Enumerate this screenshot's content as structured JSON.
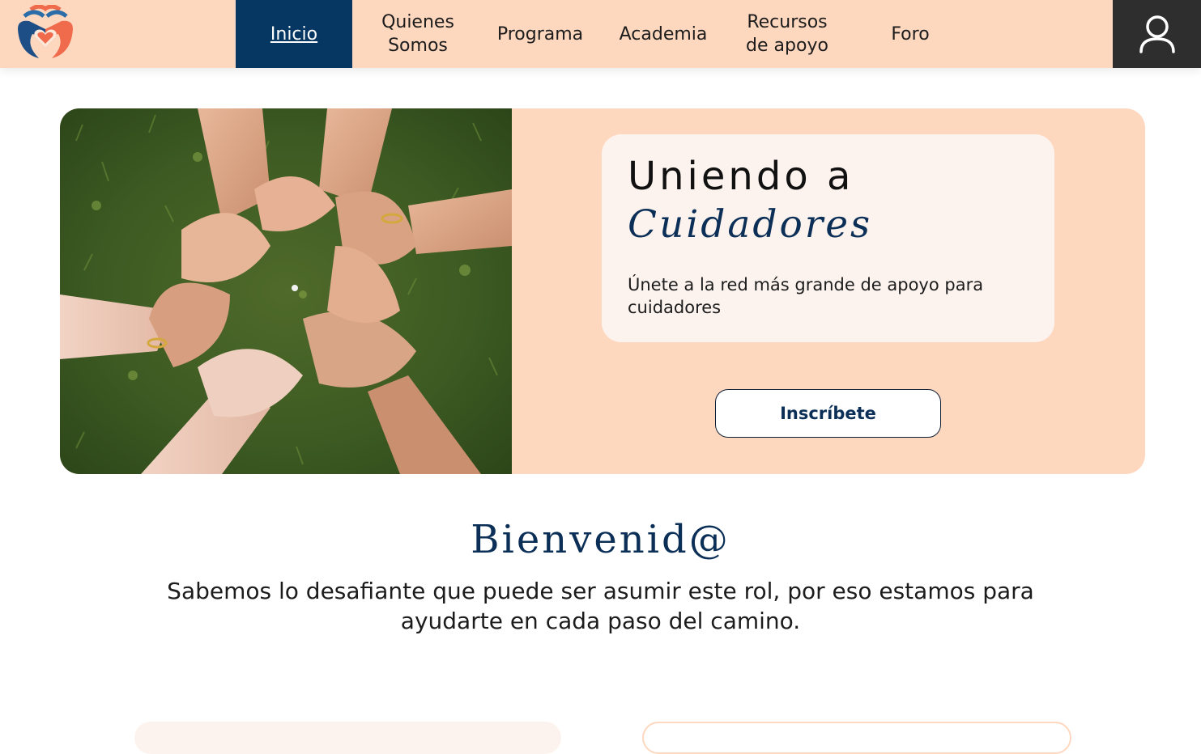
{
  "nav": {
    "items": [
      {
        "label": "Inicio",
        "active": true
      },
      {
        "label": "Quienes\nSomos",
        "active": false
      },
      {
        "label": "Programa",
        "active": false
      },
      {
        "label": "Academia",
        "active": false
      },
      {
        "label": "Recursos\nde apoyo",
        "active": false
      },
      {
        "label": "Foro",
        "active": false
      }
    ],
    "logo_icon": "hands-heart-logo",
    "user_icon": "user-icon"
  },
  "hero": {
    "image": "hands-holding-wrists-circle-photo",
    "title_line1": "Uniendo a",
    "title_line2": "Cuidadores",
    "subtitle": "Únete a la red más grande de apoyo para cuidadores",
    "cta_label": "Inscríbete"
  },
  "welcome": {
    "title": "Bienvenid@",
    "text": "Sabemos lo desafiante que puede ser asumir este rol, por eso estamos para ayudarte en cada paso del camino."
  },
  "colors": {
    "nav_bg": "#fed7bf",
    "nav_active": "#063763",
    "accent_navy": "#0b2f57",
    "card_bg": "#fdf3ee",
    "user_btn_bg": "#2e2e2e"
  }
}
